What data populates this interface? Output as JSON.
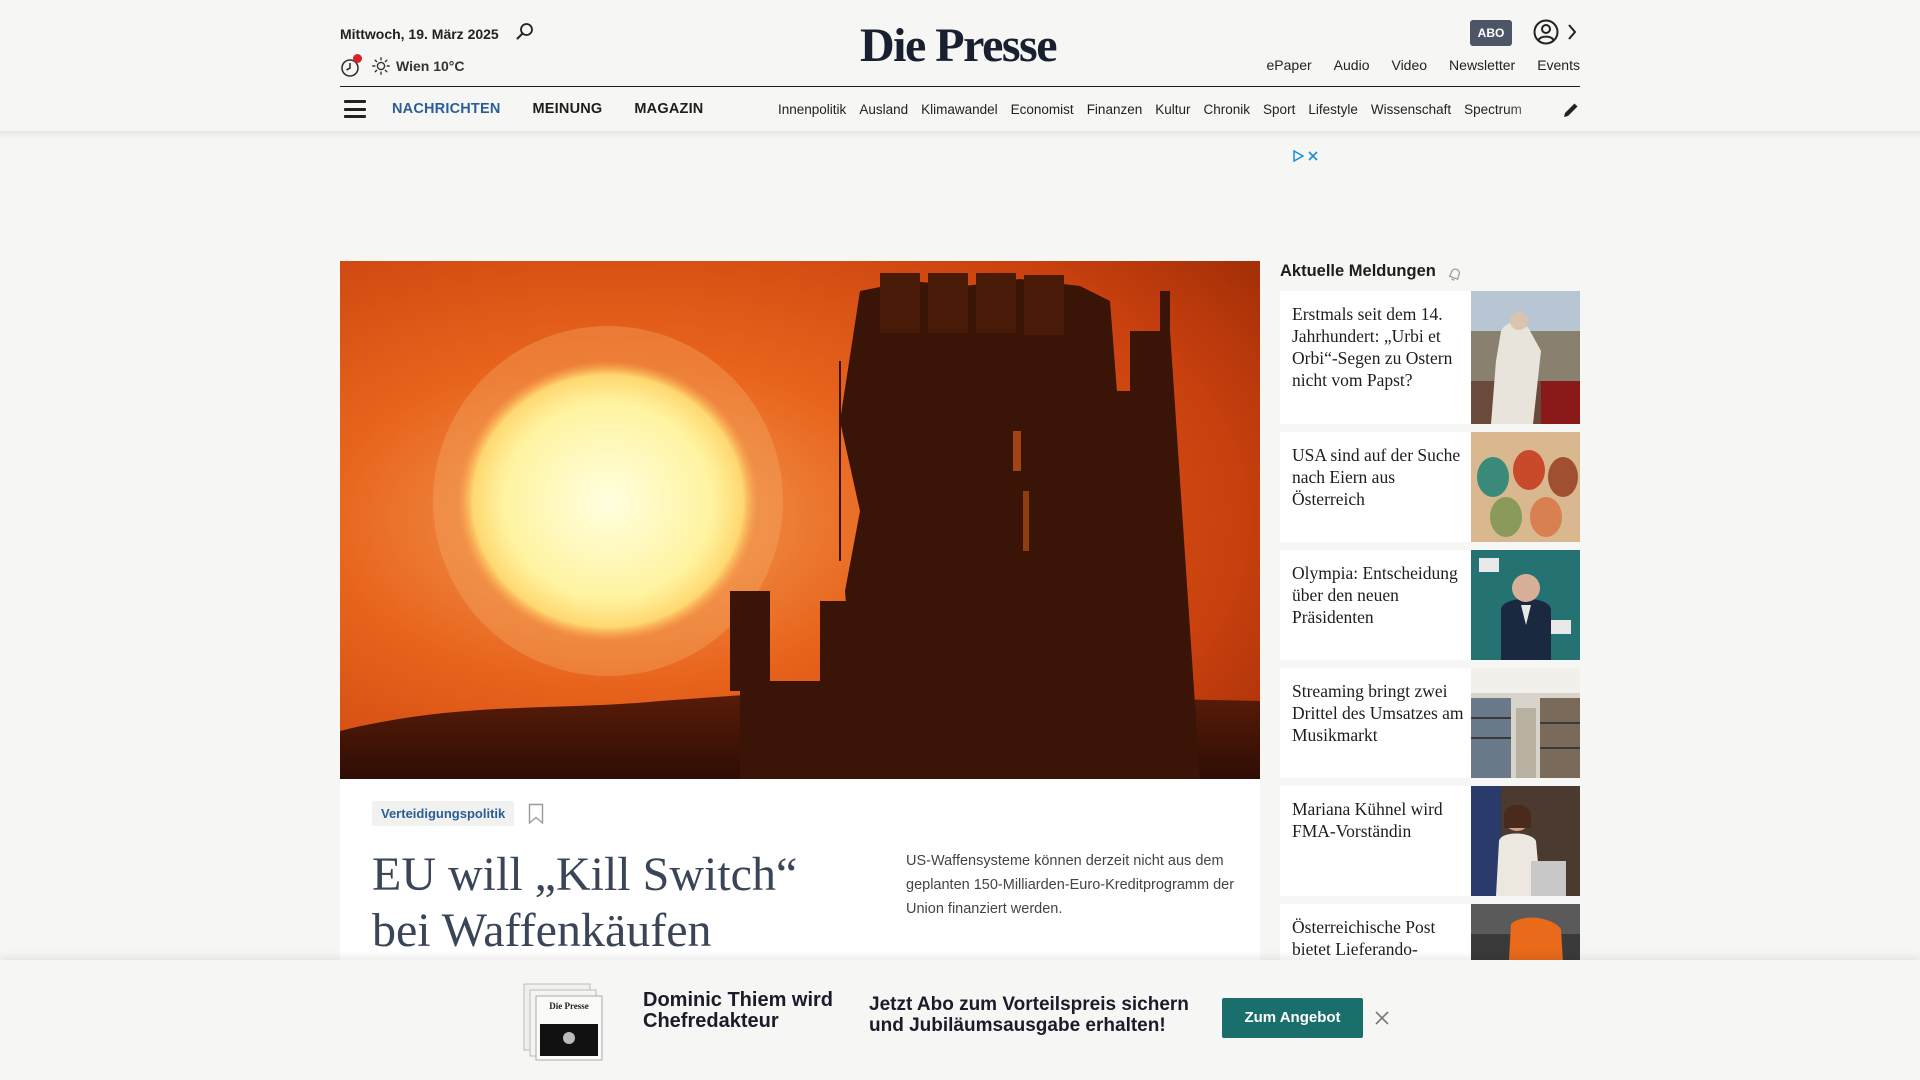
{
  "header": {
    "date": "Mittwoch, 19. März 2025",
    "weather": "Wien 10°C",
    "logo": "Die Presse",
    "abo_label": "ABO",
    "top_links": [
      "ePaper",
      "Audio",
      "Video",
      "Newsletter",
      "Events"
    ],
    "main_nav": [
      "NACHRICHTEN",
      "MEINUNG",
      "MAGAZIN"
    ],
    "sections": [
      "Innenpolitik",
      "Ausland",
      "Klimawandel",
      "Economist",
      "Finanzen",
      "Kultur",
      "Chronik",
      "Sport",
      "Lifestyle",
      "Wissenschaft",
      "Spectrum"
    ]
  },
  "hero": {
    "tag": "Verteidigungspolitik",
    "headline": "EU will „Kill Switch“ bei Waffenkäufen",
    "teaser": "US-Waffensysteme können derzeit nicht aus dem geplanten 150-Milliarden-Euro-Kreditprogramm der Union finanziert werden."
  },
  "sidebar": {
    "title": "Aktuelle Meldungen",
    "items": [
      "Erstmals seit dem 14. Jahrhundert: „Urbi et Orbi“-Segen zu Ostern nicht vom Papst?",
      "USA sind auf der Suche nach Eiern aus Österreich",
      "Olympia: Entscheidung über den neuen Präsidenten",
      "Streaming bringt zwei Drittel des Umsatzes am Musikmarkt",
      "Mariana Kühnel wird FMA-Vorständin",
      "Österreichische Post bietet Lieferando-"
    ]
  },
  "promo": {
    "title": "Dominic Thiem wird Chefredakteur",
    "offer": "Jetzt Abo zum Vorteilspreis sichern und Jubiläumsausgabe erhalten!",
    "button": "Zum Angebot"
  },
  "colors": {
    "accent_blue": "#2c5e96",
    "promo_button": "#1a6e6b",
    "headline": "#3a4658"
  }
}
